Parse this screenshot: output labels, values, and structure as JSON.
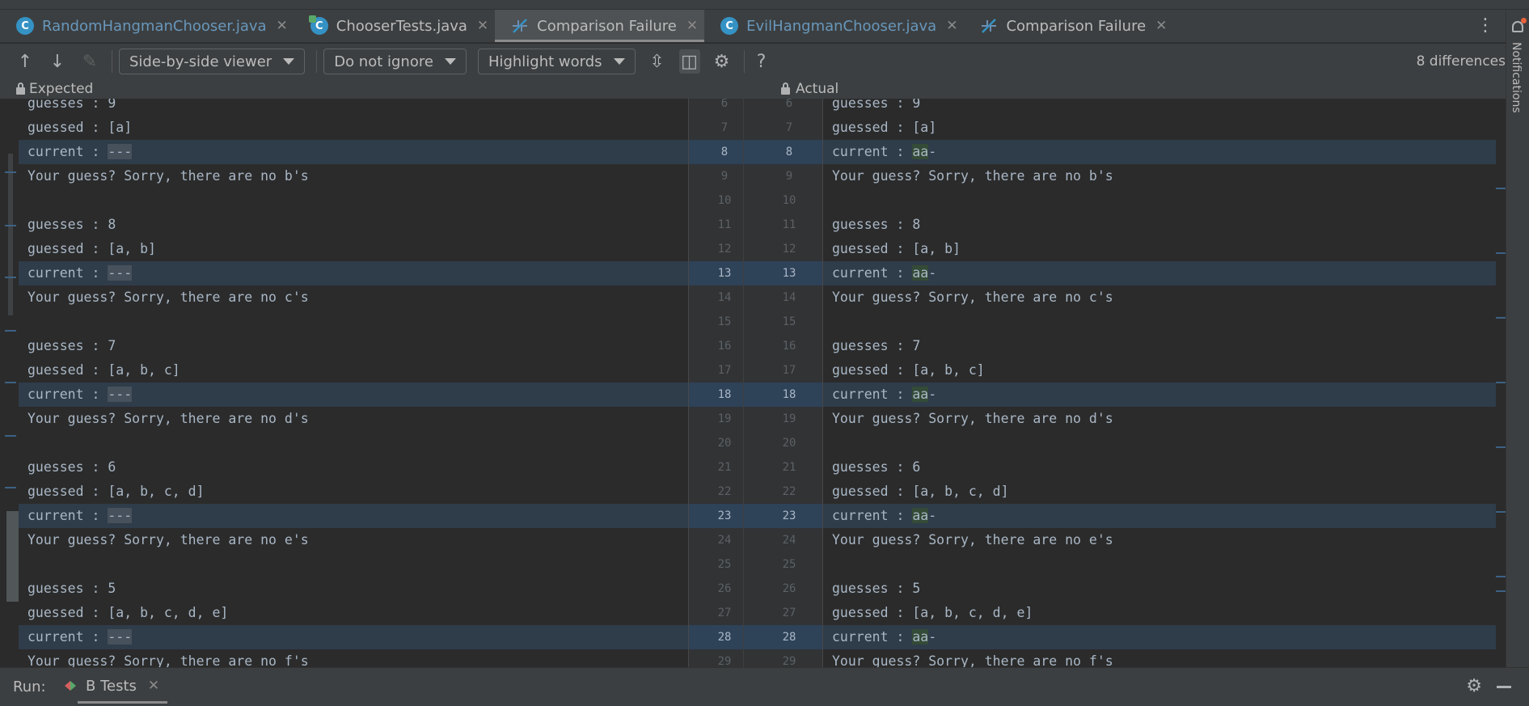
{
  "tabs": [
    {
      "label": "RandomHangmanChooser.java",
      "icon": "java-class-icon",
      "style": "java",
      "active": false
    },
    {
      "label": "ChooserTests.java",
      "icon": "java-test-class-icon",
      "style": "plain",
      "active": false
    },
    {
      "label": "Comparison Failure",
      "icon": "diff-icon",
      "style": "plain",
      "active": true
    },
    {
      "label": "EvilHangmanChooser.java",
      "icon": "java-class-icon",
      "style": "java",
      "active": false
    },
    {
      "label": "Comparison Failure",
      "icon": "diff-icon",
      "style": "plain",
      "active": false
    }
  ],
  "toolbar": {
    "viewer_label": "Side-by-side viewer",
    "ignore_label": "Do not ignore",
    "highlight_label": "Highlight words",
    "help_label": "?",
    "differences_text": "8 differences"
  },
  "headers": {
    "expected": "Expected",
    "actual": "Actual"
  },
  "left_lines": [
    {
      "text": "guesses : 9"
    },
    {
      "text": "guessed : [a]"
    },
    {
      "prefix": "current : ",
      "highlight": "---",
      "changed": true
    },
    {
      "text": "Your guess? Sorry, there are no b's"
    },
    {
      "text": ""
    },
    {
      "text": "guesses : 8"
    },
    {
      "text": "guessed : [a, b]"
    },
    {
      "prefix": "current : ",
      "highlight": "---",
      "changed": true
    },
    {
      "text": "Your guess? Sorry, there are no c's"
    },
    {
      "text": ""
    },
    {
      "text": "guesses : 7"
    },
    {
      "text": "guessed : [a, b, c]"
    },
    {
      "prefix": "current : ",
      "highlight": "---",
      "changed": true
    },
    {
      "text": "Your guess? Sorry, there are no d's"
    },
    {
      "text": ""
    },
    {
      "text": "guesses : 6"
    },
    {
      "text": "guessed : [a, b, c, d]"
    },
    {
      "prefix": "current : ",
      "highlight": "---",
      "changed": true
    },
    {
      "text": "Your guess? Sorry, there are no e's"
    },
    {
      "text": ""
    },
    {
      "text": "guesses : 5"
    },
    {
      "text": "guessed : [a, b, c, d, e]"
    },
    {
      "prefix": "current : ",
      "highlight": "---",
      "changed": true
    },
    {
      "text": "Your guess? Sorry, there are no f's"
    }
  ],
  "right_lines": [
    {
      "text": "guesses : 9"
    },
    {
      "text": "guessed : [a]"
    },
    {
      "prefix": "current : ",
      "highlight": "aa",
      "suffix": "-",
      "changed": true
    },
    {
      "text": "Your guess? Sorry, there are no b's"
    },
    {
      "text": ""
    },
    {
      "text": "guesses : 8"
    },
    {
      "text": "guessed : [a, b]"
    },
    {
      "prefix": "current : ",
      "highlight": "aa",
      "suffix": "-",
      "changed": true
    },
    {
      "text": "Your guess? Sorry, there are no c's"
    },
    {
      "text": ""
    },
    {
      "text": "guesses : 7"
    },
    {
      "text": "guessed : [a, b, c]"
    },
    {
      "prefix": "current : ",
      "highlight": "aa",
      "suffix": "-",
      "changed": true
    },
    {
      "text": "Your guess? Sorry, there are no d's"
    },
    {
      "text": ""
    },
    {
      "text": "guesses : 6"
    },
    {
      "text": "guessed : [a, b, c, d]"
    },
    {
      "prefix": "current : ",
      "highlight": "aa",
      "suffix": "-",
      "changed": true
    },
    {
      "text": "Your guess? Sorry, there are no e's"
    },
    {
      "text": ""
    },
    {
      "text": "guesses : 5"
    },
    {
      "text": "guessed : [a, b, c, d, e]"
    },
    {
      "prefix": "current : ",
      "highlight": "aa",
      "suffix": "-",
      "changed": true
    },
    {
      "text": "Your guess? Sorry, there are no f's"
    }
  ],
  "gutter_numbers": [
    {
      "left": "6",
      "right": "6"
    },
    {
      "left": "7",
      "right": "7"
    },
    {
      "left": "8",
      "right": "8",
      "changed": true
    },
    {
      "left": "9",
      "right": "9"
    },
    {
      "left": "10",
      "right": "10"
    },
    {
      "left": "11",
      "right": "11"
    },
    {
      "left": "12",
      "right": "12"
    },
    {
      "left": "13",
      "right": "13",
      "changed": true
    },
    {
      "left": "14",
      "right": "14"
    },
    {
      "left": "15",
      "right": "15"
    },
    {
      "left": "16",
      "right": "16"
    },
    {
      "left": "17",
      "right": "17"
    },
    {
      "left": "18",
      "right": "18",
      "changed": true
    },
    {
      "left": "19",
      "right": "19"
    },
    {
      "left": "20",
      "right": "20"
    },
    {
      "left": "21",
      "right": "21"
    },
    {
      "left": "22",
      "right": "22"
    },
    {
      "left": "23",
      "right": "23",
      "changed": true
    },
    {
      "left": "24",
      "right": "24"
    },
    {
      "left": "25",
      "right": "25"
    },
    {
      "left": "26",
      "right": "26"
    },
    {
      "left": "27",
      "right": "27"
    },
    {
      "left": "28",
      "right": "28",
      "changed": true
    },
    {
      "left": "29",
      "right": "29"
    }
  ],
  "notifications": {
    "label": "Notifications"
  },
  "run": {
    "label": "Run:",
    "tab_label": "B Tests"
  },
  "colors": {
    "changed_line": "#2f3c4a",
    "deleted_word": "#46515c",
    "inserted_word": "#344b37",
    "accent": "#3592c4"
  }
}
